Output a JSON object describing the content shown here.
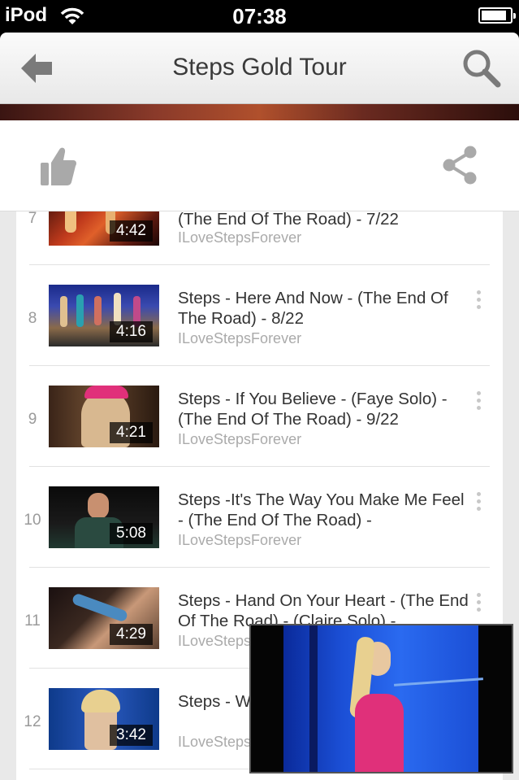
{
  "status_bar": {
    "carrier": "iPod",
    "time": "07:38",
    "battery_level": 0.88
  },
  "nav": {
    "title": "Steps Gold Tour",
    "back_icon": "back-arrow-icon",
    "search_icon": "search-icon"
  },
  "actions": {
    "like_icon": "thumbs-up-icon",
    "share_icon": "share-icon"
  },
  "items": [
    {
      "index": "7",
      "duration": "4:42",
      "title": "(The End Of The Road) - 7/22",
      "channel": "ILoveStepsForever"
    },
    {
      "index": "8",
      "duration": "4:16",
      "title": "Steps - Here And Now - (The End Of The Road) - 8/22",
      "channel": "ILoveStepsForever"
    },
    {
      "index": "9",
      "duration": "4:21",
      "title": "Steps - If You Believe - (Faye Solo) - (The End Of The Road) - 9/22",
      "channel": "ILoveStepsForever"
    },
    {
      "index": "10",
      "duration": "5:08",
      "title": "Steps -It's The Way You Make Me Feel - (The End Of The Road) -",
      "channel": "ILoveStepsForever"
    },
    {
      "index": "11",
      "duration": "4:29",
      "title": "Steps - Hand On Your Heart - (The End Of The Road) - (Claire Solo) -",
      "channel": "ILoveSteps"
    },
    {
      "index": "12",
      "duration": "3:42",
      "title": "Steps - W (The End",
      "channel": "ILoveSteps"
    }
  ],
  "colors": {
    "accent_gray": "#7a7a7a",
    "mini_player_bg": "#1b4fd6",
    "performer_top": "#e0307a"
  }
}
